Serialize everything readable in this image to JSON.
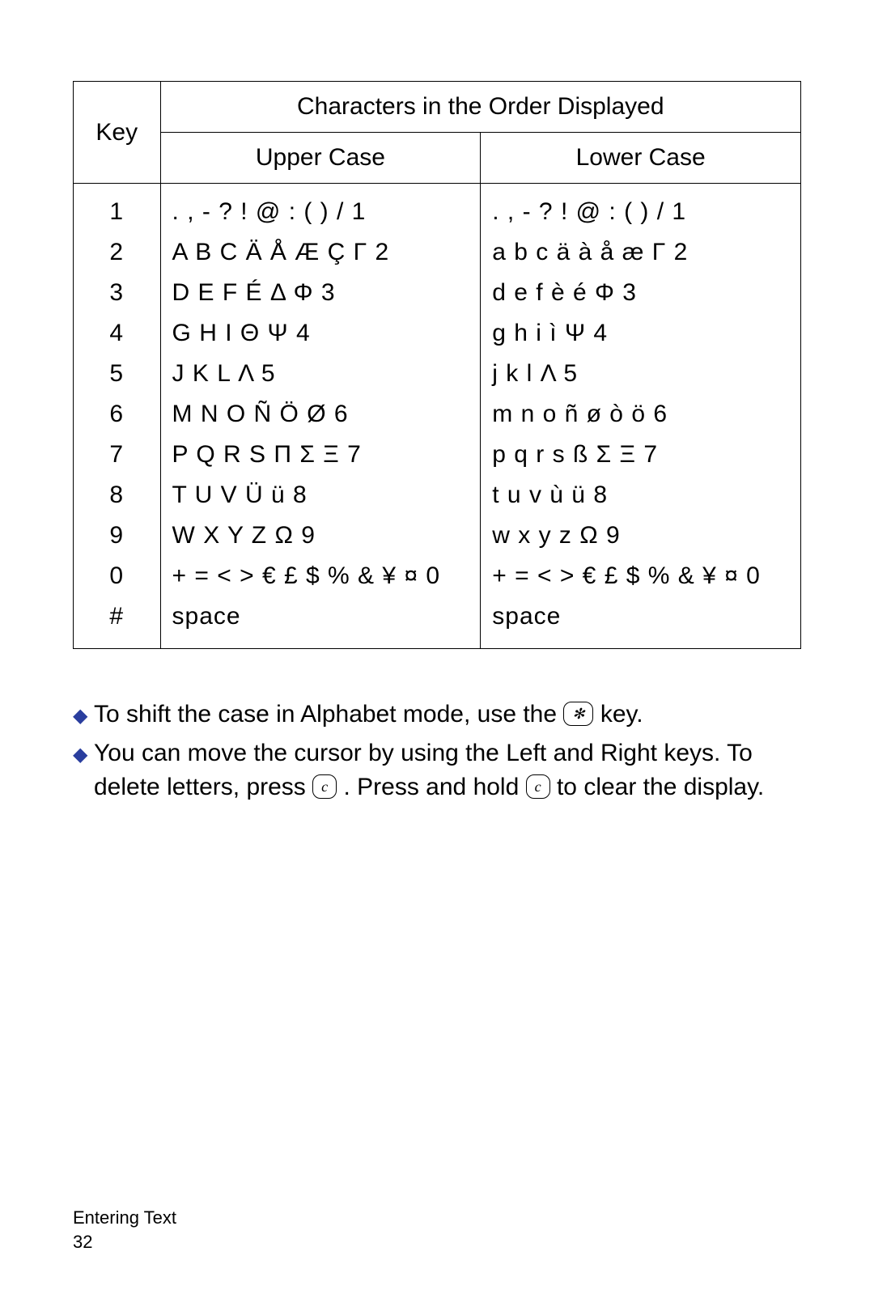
{
  "header": {
    "key_col": "Key",
    "chars_title": "Characters in the Order Displayed",
    "upper": "Upper Case",
    "lower": "Lower Case"
  },
  "rows": [
    {
      "key": "1",
      "upper": ". , - ? ! @ : ( ) / 1",
      "lower": ". , - ? ! @ : ( ) / 1"
    },
    {
      "key": "2",
      "upper": "A B C Ä Å Æ Ç Γ 2",
      "lower": "a b c ä à å æ Γ 2"
    },
    {
      "key": "3",
      "upper": "D E F É Δ Φ 3",
      "lower": "d e f è é Φ 3"
    },
    {
      "key": "4",
      "upper": "G H I Θ Ψ 4",
      "lower": "g h i ì Ψ 4"
    },
    {
      "key": "5",
      "upper": "J K L Λ 5",
      "lower": "j k l Λ 5"
    },
    {
      "key": "6",
      "upper": "M N O Ñ Ö Ø 6",
      "lower": "m n o ñ ø ò ö 6"
    },
    {
      "key": "7",
      "upper": "P Q R S Π Σ Ξ 7",
      "lower": "p q r s ß Σ Ξ 7"
    },
    {
      "key": "8",
      "upper": "T U V Ü ü 8",
      "lower": "t u v ù ü 8"
    },
    {
      "key": "9",
      "upper": "W X Y Z Ω 9",
      "lower": "w x y z Ω 9"
    },
    {
      "key": "0",
      "upper": "+ = < > € £ $ % & ¥ ¤ 0",
      "lower": "+ = < > € £ $ % & ¥ ¤ 0"
    },
    {
      "key": "#",
      "upper": "space",
      "lower": "space"
    }
  ],
  "notes": {
    "bullet_a_pre": "To shift the case in Alphabet mode, use the ",
    "bullet_a_key": "✻",
    "bullet_a_post": " key.",
    "bullet_b_pre": "You can move the cursor by using the Left and Right keys. To delete letters, press ",
    "bullet_b_key1": "c",
    "bullet_b_mid": ". Press and hold ",
    "bullet_b_key2": "c",
    "bullet_b_post": " to clear the display."
  },
  "footer": {
    "section": "Entering Text",
    "page": "32"
  }
}
